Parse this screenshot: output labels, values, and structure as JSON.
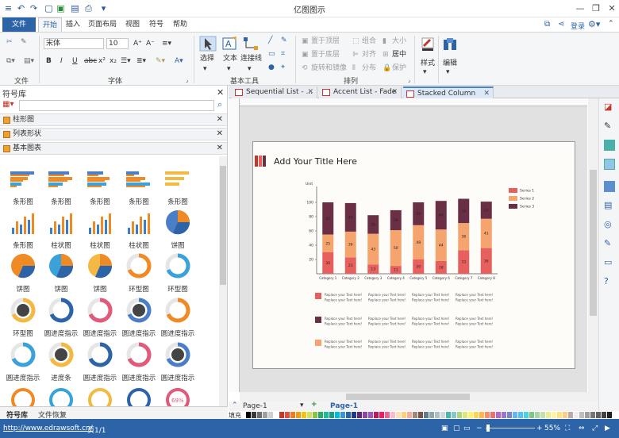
{
  "app": {
    "title": "亿图图示"
  },
  "quick_access": {
    "login": "登录"
  },
  "tabs": [
    "文件",
    "开始",
    "插入",
    "页面布局",
    "视图",
    "符号",
    "帮助"
  ],
  "ribbon": {
    "file_group": "文件",
    "font_group": "字体",
    "tools_group": "基本工具",
    "arrange_group": "排列",
    "font_name": "宋体",
    "font_size": "10",
    "select_label": "选择",
    "text_label": "文本",
    "connector_label": "连接线",
    "style_label": "样式",
    "edit_label": "编辑",
    "arrange": {
      "bring_front": "置于顶层",
      "send_back": "置于底层",
      "rotate_mirror": "旋转和镜像",
      "group": "组合",
      "align": "对齐",
      "distribute": "分布",
      "size": "大小",
      "center": "居中",
      "protect": "保护"
    }
  },
  "library": {
    "title": "符号库",
    "categories": [
      "柱形图",
      "列表形状",
      "基本图表"
    ],
    "shapes": [
      "条形图",
      "条形图",
      "条形图",
      "条形图",
      "条形图",
      "条形图",
      "柱状图",
      "柱状图",
      "柱状图",
      "饼图",
      "饼图",
      "饼图",
      "饼图",
      "环型图",
      "环型图",
      "环型图",
      "圆进度指示",
      "圆进度指示",
      "圆进度指示",
      "圆进度指示",
      "圆进度指示",
      "进度条",
      "圆进度指示",
      "圆进度指示",
      "圆进度指示",
      "",
      "",
      "",
      "",
      ""
    ],
    "progress_text": "69%",
    "bottom_tabs": [
      "符号库",
      "文件恢复"
    ]
  },
  "doc_tabs": [
    "Sequential List - ...",
    "Accent List - Fade",
    "Stacked Column Cha..."
  ],
  "page": {
    "title": "Add Your Title Here",
    "caption": "Replace your Text here!",
    "name": "Page-1",
    "fill_label": "填充"
  },
  "chart_data": {
    "type": "bar",
    "stacked": true,
    "ylabel": "Unit",
    "ylim": [
      0,
      120
    ],
    "yticks": [
      20,
      40,
      60,
      80,
      100
    ],
    "categories": [
      "Category 1",
      "Category 2",
      "Category 3",
      "Category 4",
      "Category 5",
      "Category 6",
      "Category 7",
      "Category 8"
    ],
    "series": [
      {
        "name": "Series 1",
        "color": "#e8605e",
        "values": [
          30,
          23,
          13,
          11,
          20,
          18,
          33,
          36
        ]
      },
      {
        "name": "Series 2",
        "color": "#f5a46e",
        "values": [
          25,
          36,
          43,
          50,
          48,
          44,
          38,
          41
        ]
      },
      {
        "name": "Series 3",
        "color": "#6b2f45",
        "values": [
          45,
          40,
          26,
          28,
          32,
          40,
          34,
          24
        ]
      }
    ],
    "data_labels": [
      [
        "30",
        "25",
        "45"
      ],
      [
        "23",
        "36",
        "40"
      ],
      [
        "13",
        "43",
        "26"
      ],
      [
        "11",
        "50",
        "28"
      ],
      [
        "20",
        "48",
        "32"
      ],
      [
        "18",
        "44",
        "40"
      ],
      [
        "33",
        "38",
        "34"
      ],
      [
        "36",
        "41",
        "24"
      ]
    ],
    "legend": "right"
  },
  "status": {
    "url": "http://www.edrawsoft.cn/",
    "page": "页1/1",
    "zoom": "55%"
  },
  "colors": {
    "accent": "#2d64a8",
    "brand": "#c0392b"
  }
}
